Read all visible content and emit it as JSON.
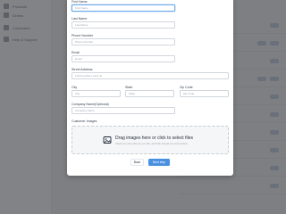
{
  "background": {
    "nav_items": [
      "Products",
      "Orders",
      "Customers",
      "Help & Support"
    ]
  },
  "form": {
    "fields": {
      "first_name": {
        "label": "First Name",
        "placeholder": "First Name"
      },
      "last_name": {
        "label": "Last Name",
        "placeholder": "Last Name"
      },
      "phone": {
        "label": "Phone Number",
        "placeholder": "Phone Number"
      },
      "email": {
        "label": "Email",
        "placeholder": "Email"
      },
      "street": {
        "label": "Street Address",
        "placeholder": "123 Anywhere Lane St"
      },
      "city": {
        "label": "City",
        "placeholder": "City"
      },
      "state": {
        "label": "State",
        "placeholder": "State"
      },
      "zip": {
        "label": "Zip Code",
        "placeholder": "Zip Code"
      },
      "company": {
        "label": "Company Name(Optional)",
        "placeholder": "Company Name"
      }
    },
    "images": {
      "label": "Customer Images",
      "drop_title": "Drag images here or click to select files",
      "drop_subtitle": "Attach as many files as you like, each file should not exceed 5mb"
    },
    "buttons": {
      "back": "Back",
      "next": "Next step"
    }
  },
  "colors": {
    "primary": "#4a90e2",
    "focus_border": "#6ea8e8",
    "overlay": "#28292e"
  }
}
